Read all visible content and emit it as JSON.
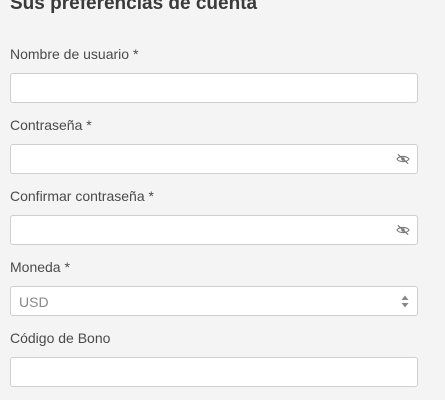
{
  "form": {
    "title": "Sus preferencias de cuenta",
    "username": {
      "label": "Nombre de usuario *",
      "value": "",
      "placeholder": ""
    },
    "password": {
      "label": "Contraseña *",
      "value": "",
      "placeholder": "",
      "icon": "eye-slash-icon"
    },
    "confirm_password": {
      "label": "Confirmar contraseña *",
      "value": "",
      "placeholder": "",
      "icon": "eye-slash-icon"
    },
    "currency": {
      "label": "Moneda *",
      "selected": "USD",
      "icon": "select-updown-icon"
    },
    "bonus_code": {
      "label": "Código de Bono",
      "value": "",
      "placeholder": ""
    }
  }
}
